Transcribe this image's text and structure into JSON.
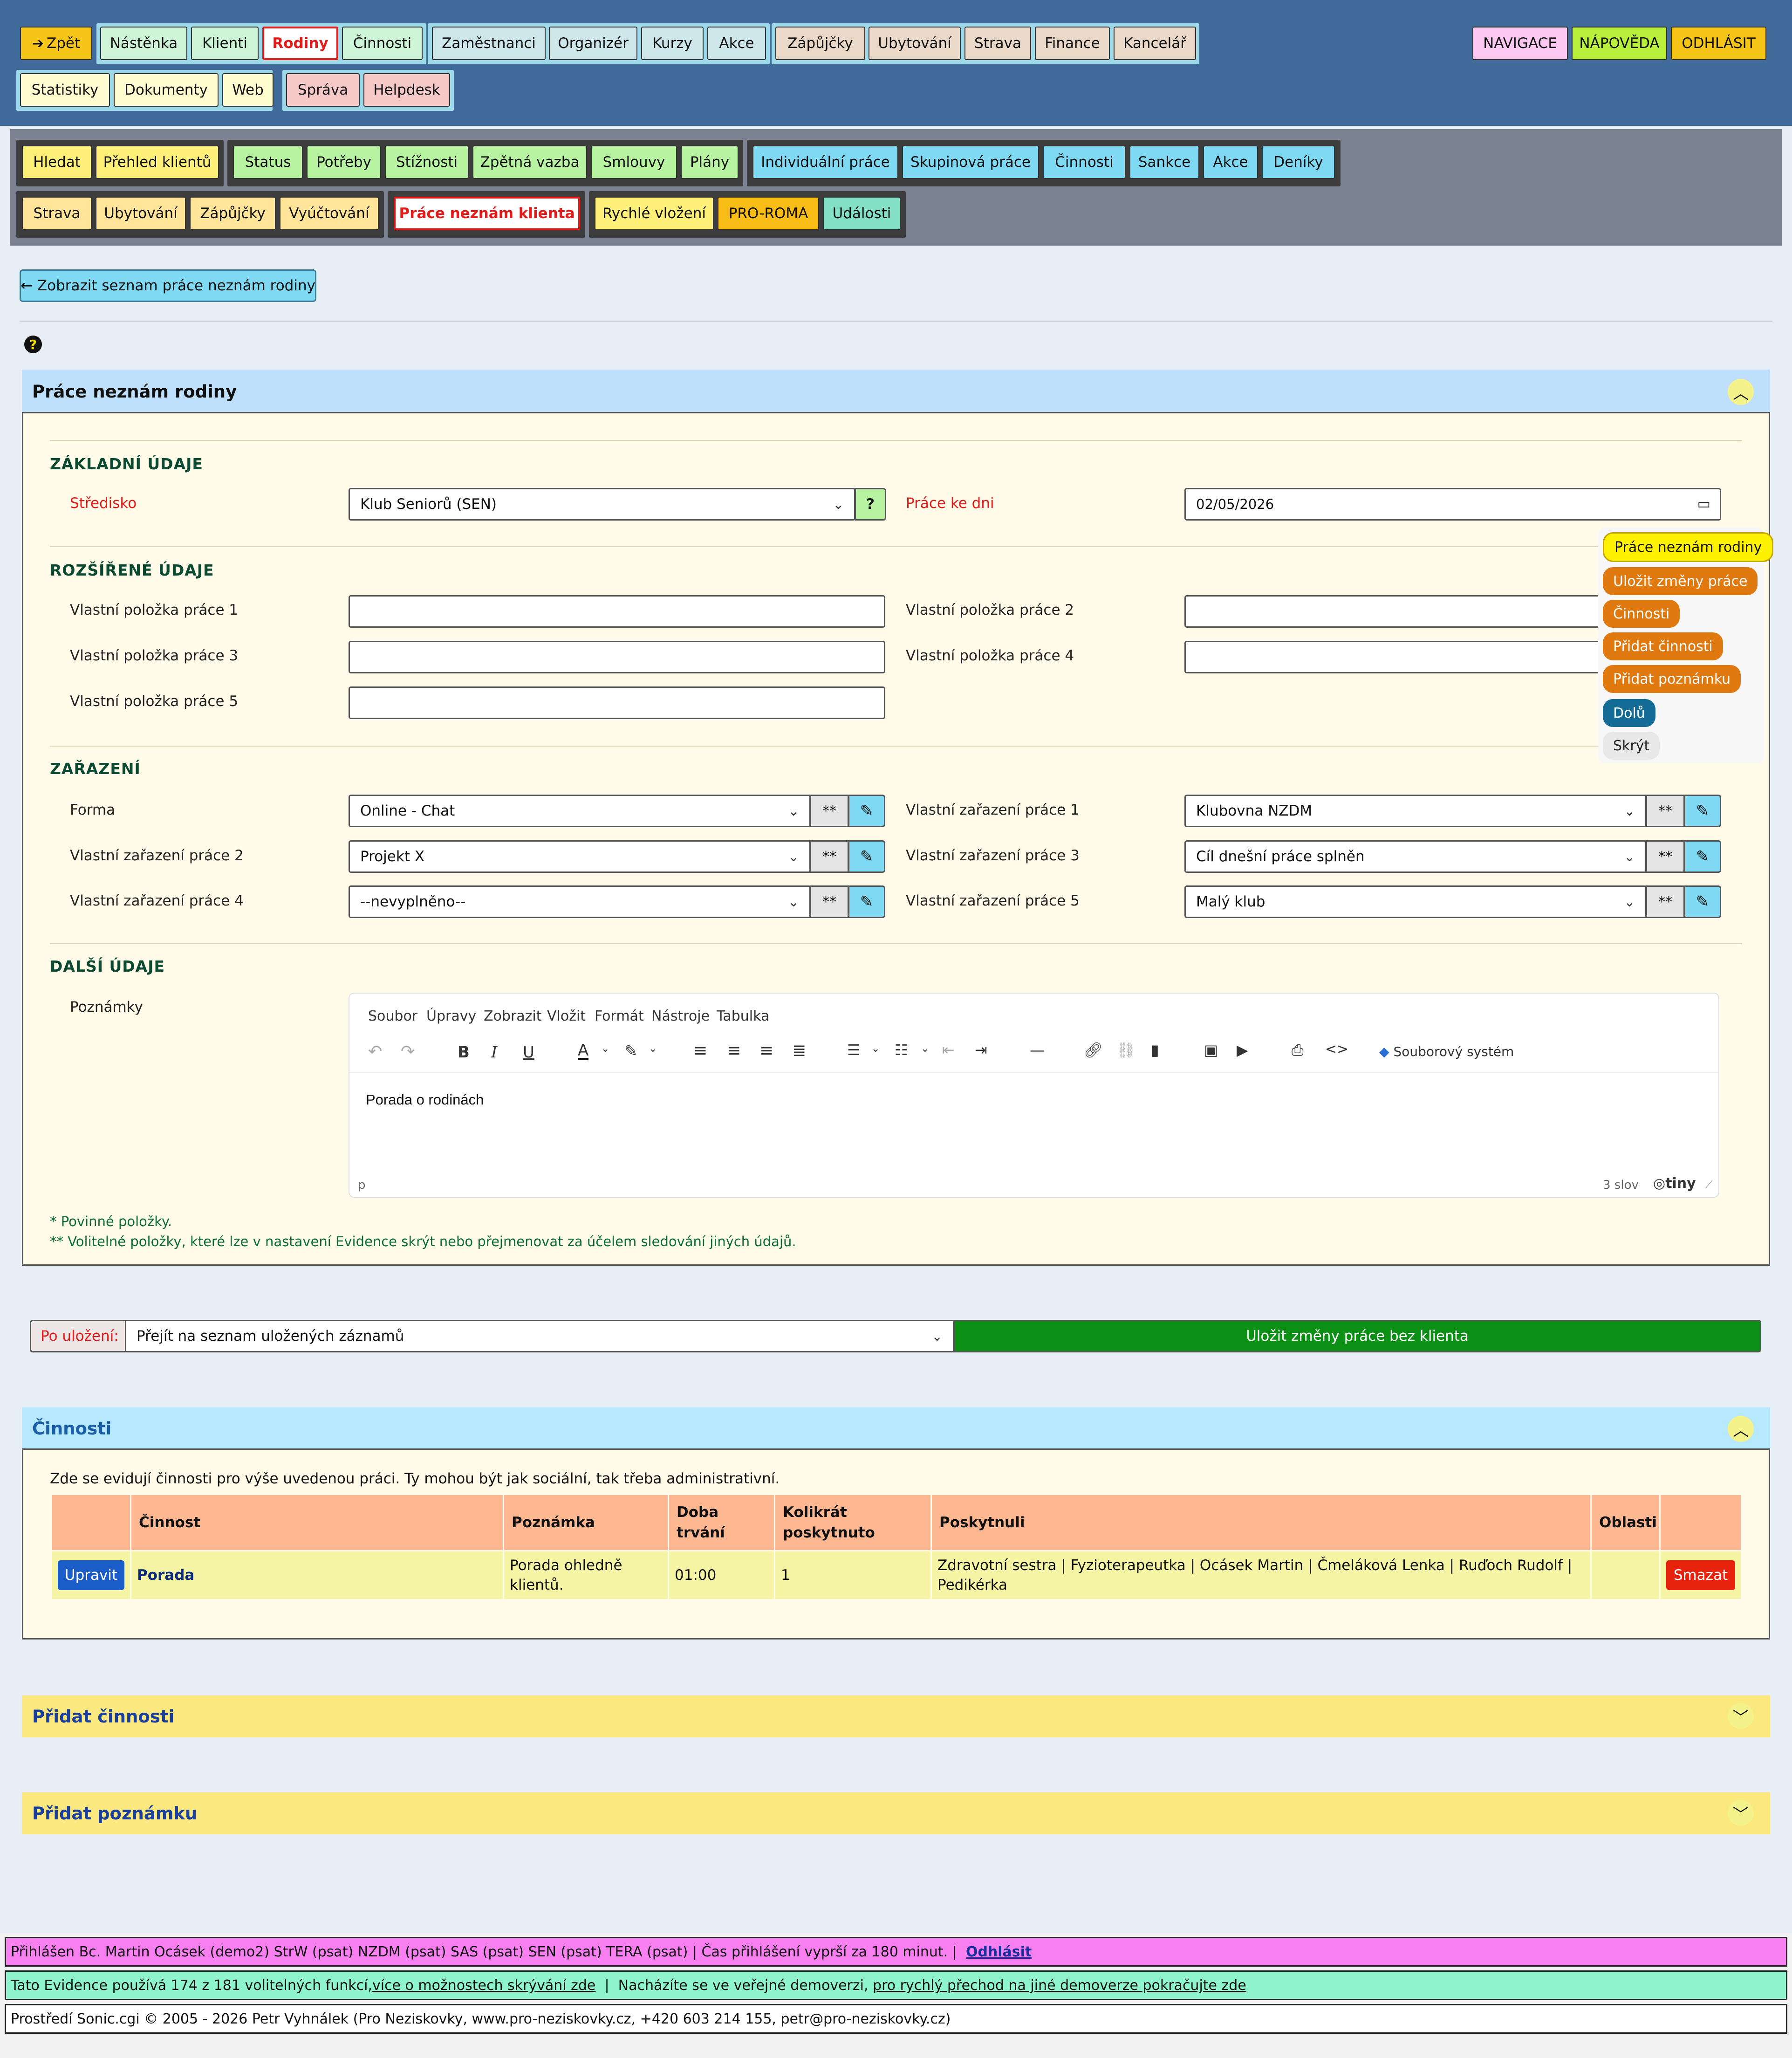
{
  "nav": {
    "row1": [
      {
        "label": "Zpět",
        "icon": "arrow-circle-left-icon"
      },
      {
        "label": "Nástěnka"
      },
      {
        "label": "Klienti"
      },
      {
        "label": "Rodiny"
      },
      {
        "label": "Činnosti"
      },
      {
        "label": "Zaměstnanci"
      },
      {
        "label": "Organizér"
      },
      {
        "label": "Kurzy"
      },
      {
        "label": "Akce"
      },
      {
        "label": "Zápůjčky"
      },
      {
        "label": "Ubytování"
      },
      {
        "label": "Strava"
      },
      {
        "label": "Finance"
      },
      {
        "label": "Kancelář"
      }
    ],
    "row2": [
      {
        "label": "Statistiky"
      },
      {
        "label": "Dokumenty"
      },
      {
        "label": "Web"
      },
      {
        "label": "Správa"
      },
      {
        "label": "Helpdesk"
      }
    ],
    "right": [
      {
        "label": "NAVIGACE"
      },
      {
        "label": "NÁPOVĚDA"
      },
      {
        "label": "ODHLÁSIT"
      }
    ]
  },
  "subnav": {
    "row1": [
      {
        "label": "Hledat"
      },
      {
        "label": "Přehled klientů"
      },
      {
        "label": "Status"
      },
      {
        "label": "Potřeby"
      },
      {
        "label": "Stížnosti"
      },
      {
        "label": "Zpětná vazba"
      },
      {
        "label": "Smlouvy"
      },
      {
        "label": "Plány"
      },
      {
        "label": "Individuální práce"
      },
      {
        "label": "Skupinová práce"
      },
      {
        "label": "Činnosti"
      },
      {
        "label": "Sankce"
      },
      {
        "label": "Akce"
      },
      {
        "label": "Deníky"
      }
    ],
    "row2": [
      {
        "label": "Strava"
      },
      {
        "label": "Ubytování"
      },
      {
        "label": "Zápůjčky"
      },
      {
        "label": "Vyúčtování"
      },
      {
        "label": "Práce neznám klienta"
      },
      {
        "label": "Rychlé vložení"
      },
      {
        "label": "PRO-ROMA"
      },
      {
        "label": "Události"
      }
    ]
  },
  "back_button": "← Zobrazit seznam práce neznám rodiny",
  "help_icon": "question-circle-icon",
  "panel": {
    "title": "Práce neznám rodiny",
    "basic": {
      "title": "ZÁKLADNÍ ÚDAJE",
      "stredisko_label": "Středisko",
      "stredisko_value": "Klub Seniorů (SEN)",
      "stredisko_help": "?",
      "date_label": "Práce ke dni",
      "date_value": "02/05/2026"
    },
    "extended": {
      "title": "ROZŠÍŘENÉ ÚDAJE",
      "items": [
        "Vlastní položka práce 1",
        "Vlastní položka práce 2",
        "Vlastní položka práce 3",
        "Vlastní položka práce 4",
        "Vlastní položka práce 5"
      ]
    },
    "classification": {
      "title": "ZAŘAZENÍ",
      "fields": [
        {
          "label": "Forma",
          "value": "Online - Chat"
        },
        {
          "label": "Vlastní zařazení práce 1",
          "value": "Klubovna NZDM"
        },
        {
          "label": "Vlastní zařazení práce 2",
          "value": "Projekt X"
        },
        {
          "label": "Vlastní zařazení práce 3",
          "value": "Cíl dnešní práce splněn"
        },
        {
          "label": "Vlastní zařazení práce 4",
          "value": "--nevyplněno--"
        },
        {
          "label": "Vlastní zařazení práce 5",
          "value": "Malý klub"
        }
      ],
      "star": "**"
    },
    "other": {
      "title": "DALŠÍ ÚDAJE",
      "notes_label": "Poznámky",
      "editor_menu": [
        "Soubor",
        "Úpravy",
        "Zobrazit",
        "Vložit",
        "Formát",
        "Nástroje",
        "Tabulka"
      ],
      "filesystem": "Souborový systém",
      "content": "Porada o rodinách",
      "status_path": "p",
      "word_count": "3 slov",
      "brand": "tiny"
    },
    "note1": "* Povinné položky.",
    "note2": "** Volitelné položky, které lze v nastavení Evidence skrýt nebo přejmenovat za účelem sledování jiných údajů."
  },
  "floating_menu": [
    "Práce neznám rodiny",
    "Uložit změny práce",
    "Činnosti",
    "Přidat činnosti",
    "Přidat poznámku",
    "Dolů",
    "Skrýt"
  ],
  "save_bar": {
    "label": "Po uložení:",
    "option": "Přejít na seznam uložených záznamů",
    "button": "Uložit změny práce bez klienta"
  },
  "activities": {
    "title": "Činnosti",
    "intro": "Zde se evidují činnosti pro výše uvedenou práci. Ty mohou být jak sociální, tak třeba administrativní.",
    "columns": [
      "",
      "Činnost",
      "Poznámka",
      "Doba trvání",
      "Kolikrát poskytnuto",
      "Poskytnuli",
      "Oblasti",
      ""
    ],
    "rows": [
      {
        "edit": "Upravit",
        "activity": "Porada",
        "note": "Porada ohledně klientů.",
        "duration": "01:00",
        "count": "1",
        "providers": "Zdravotní sestra | Fyzioterapeutka | Ocásek Martin | Čmeláková Lenka | Ruďoch Rudolf | Pedikérka",
        "areas": "",
        "delete": "Smazat"
      }
    ]
  },
  "add_activity": "Přidat činnosti",
  "add_note": "Přidat poznámku",
  "footer": {
    "login": "Přihlášen Bc. Martin Ocásek (demo2) StrW (psat) NZDM (psat) SAS (psat) SEN (psat) TERA (psat)  |  Čas přihlášení vyprší za 180 minut.  |",
    "logout": "Odhlásit",
    "features": "Tato Evidence používá 174 z 181 volitelných funkcí, ",
    "features_link": "více o možnostech skrývání zde",
    "demo": "  |  Nacházíte se ve veřejné demoverzi, ",
    "demo_link": "pro rychlý přechod na jiné demoverze pokračujte zde",
    "copyright": "Prostředí Sonic.cgi © 2005 - 2026 Petr Vyhnálek (Pro Neziskovky, www.pro-neziskovky.cz, +420 603 214 155, petr@pro-neziskovky.cz)"
  }
}
